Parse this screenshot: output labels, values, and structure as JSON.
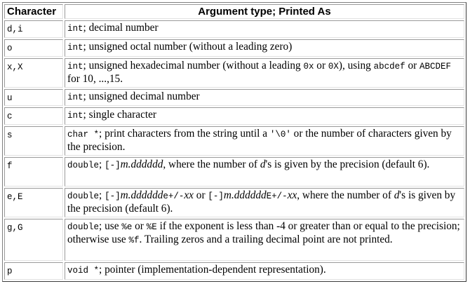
{
  "headers": {
    "character": "Character",
    "argument": "Argument type; Printed As"
  },
  "rows": [
    {
      "char": "d,i",
      "parts": [
        {
          "t": "int",
          "mono": true
        },
        {
          "t": "; decimal number"
        }
      ]
    },
    {
      "char": "o",
      "parts": [
        {
          "t": "int",
          "mono": true
        },
        {
          "t": "; unsigned octal number (without a leading zero)"
        }
      ]
    },
    {
      "char": "x,X",
      "parts": [
        {
          "t": "int",
          "mono": true
        },
        {
          "t": "; unsigned hexadecimal number (without a leading "
        },
        {
          "t": "0x",
          "mono": true
        },
        {
          "t": " or "
        },
        {
          "t": "0X",
          "mono": true
        },
        {
          "t": "), using "
        },
        {
          "t": "abcdef",
          "mono": true
        },
        {
          "t": " or "
        },
        {
          "t": "ABCDEF",
          "mono": true
        },
        {
          "t": " for 10, ...,15."
        }
      ]
    },
    {
      "char": "u",
      "parts": [
        {
          "t": "int",
          "mono": true
        },
        {
          "t": "; unsigned decimal number"
        }
      ]
    },
    {
      "char": "c",
      "parts": [
        {
          "t": "int",
          "mono": true
        },
        {
          "t": "; single character"
        }
      ]
    },
    {
      "char": "s",
      "parts": [
        {
          "t": "char *",
          "mono": true
        },
        {
          "t": "; print characters from the string until a "
        },
        {
          "t": "'\\0'",
          "mono": true
        },
        {
          "t": " or the number of characters given by the precision."
        }
      ]
    },
    {
      "char": "f",
      "parts": [
        {
          "t": "double",
          "mono": true
        },
        {
          "t": "; "
        },
        {
          "t": "[-]",
          "mono": true
        },
        {
          "t": "m.dddddd",
          "italic": true
        },
        {
          "t": ", where the number of "
        },
        {
          "t": "d",
          "italic": true
        },
        {
          "t": "'s is given by the precision (default 6)."
        }
      ]
    },
    {
      "char": "e,E",
      "parts": [
        {
          "t": "double",
          "mono": true
        },
        {
          "t": "; "
        },
        {
          "t": "[-]",
          "mono": true
        },
        {
          "t": "m.dddddd",
          "italic": true
        },
        {
          "t": "e+/-",
          "mono": true
        },
        {
          "t": "xx",
          "italic": true
        },
        {
          "t": " or "
        },
        {
          "t": "[-]",
          "mono": true
        },
        {
          "t": "m.dddddd",
          "italic": true
        },
        {
          "t": "E+/-",
          "mono": true
        },
        {
          "t": "xx",
          "italic": true
        },
        {
          "t": ", where the number of "
        },
        {
          "t": "d",
          "italic": true
        },
        {
          "t": "'s is given by the precision (default 6)."
        }
      ]
    },
    {
      "char": "g,G",
      "parts": [
        {
          "t": "double",
          "mono": true
        },
        {
          "t": "; use "
        },
        {
          "t": "%e",
          "mono": true
        },
        {
          "t": " or "
        },
        {
          "t": "%E",
          "mono": true
        },
        {
          "t": " if the exponent is less than -4 or greater than or equal to the precision; otherwise use "
        },
        {
          "t": "%f",
          "mono": true
        },
        {
          "t": ". Trailing zeros and a trailing decimal point are not printed."
        }
      ]
    },
    {
      "char": "p",
      "parts": [
        {
          "t": "void *",
          "mono": true
        },
        {
          "t": "; pointer (implementation-dependent representation)."
        }
      ]
    }
  ]
}
